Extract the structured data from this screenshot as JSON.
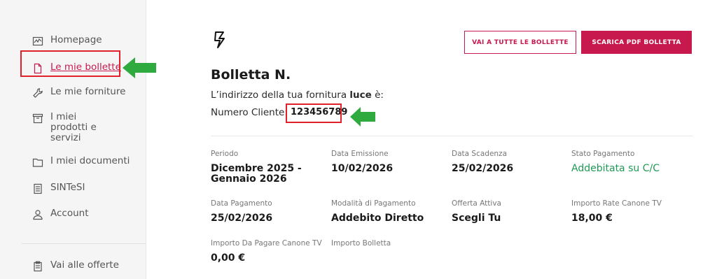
{
  "sidebar": {
    "items": [
      {
        "label": "Homepage",
        "icon": "chart-line-icon"
      },
      {
        "label": "Le mie bollette",
        "icon": "document-icon"
      },
      {
        "label": "Le mie forniture",
        "icon": "wrench-icon"
      },
      {
        "label": "I miei prodotti e servizi",
        "icon": "box-icon"
      },
      {
        "label": "I miei documenti",
        "icon": "folder-icon"
      },
      {
        "label": "SINTeSI",
        "icon": "file-lines-icon"
      },
      {
        "label": "Account",
        "icon": "user-icon"
      },
      {
        "label": "Vai alle offerte",
        "icon": "clipboard-icon"
      }
    ]
  },
  "header": {
    "all_bills_button": "VAI A TUTTE LE BOLLETTE",
    "download_pdf_button": "SCARICA PDF BOLLETTA"
  },
  "bill": {
    "title": "Bolletta N.",
    "address_prefix": "L’indirizzo della tua fornitura ",
    "address_type": "luce",
    "address_suffix": " è:",
    "client_label": "Numero Cliente:",
    "client_number": "123456789"
  },
  "fields": {
    "periodo": {
      "label": "Periodo",
      "value": "Dicembre 2025 - Gennaio 2026"
    },
    "data_emissione": {
      "label": "Data Emissione",
      "value": "10/02/2026"
    },
    "data_scadenza": {
      "label": "Data Scadenza",
      "value": "25/02/2026"
    },
    "stato_pagamento": {
      "label": "Stato Pagamento",
      "value": "Addebitata su C/C"
    },
    "data_pagamento": {
      "label": "Data Pagamento",
      "value": "25/02/2026"
    },
    "modalita_pagamento": {
      "label": "Modalità di Pagamento",
      "value": "Addebito Diretto"
    },
    "offerta_attiva": {
      "label": "Offerta Attiva",
      "value": "Scegli Tu"
    },
    "importo_rate_canone": {
      "label": "Importo Rate Canone TV",
      "value": "18,00 €"
    },
    "importo_da_pagare_canone": {
      "label": "Importo Da Pagare Canone TV",
      "value": "0,00 €"
    },
    "importo_bolletta": {
      "label": "Importo Bolletta",
      "value": ""
    }
  },
  "colors": {
    "brand": "#c8194f",
    "status_green": "#1f9a56",
    "highlight_red": "#e0202a",
    "arrow_green": "#2eaa3f"
  }
}
